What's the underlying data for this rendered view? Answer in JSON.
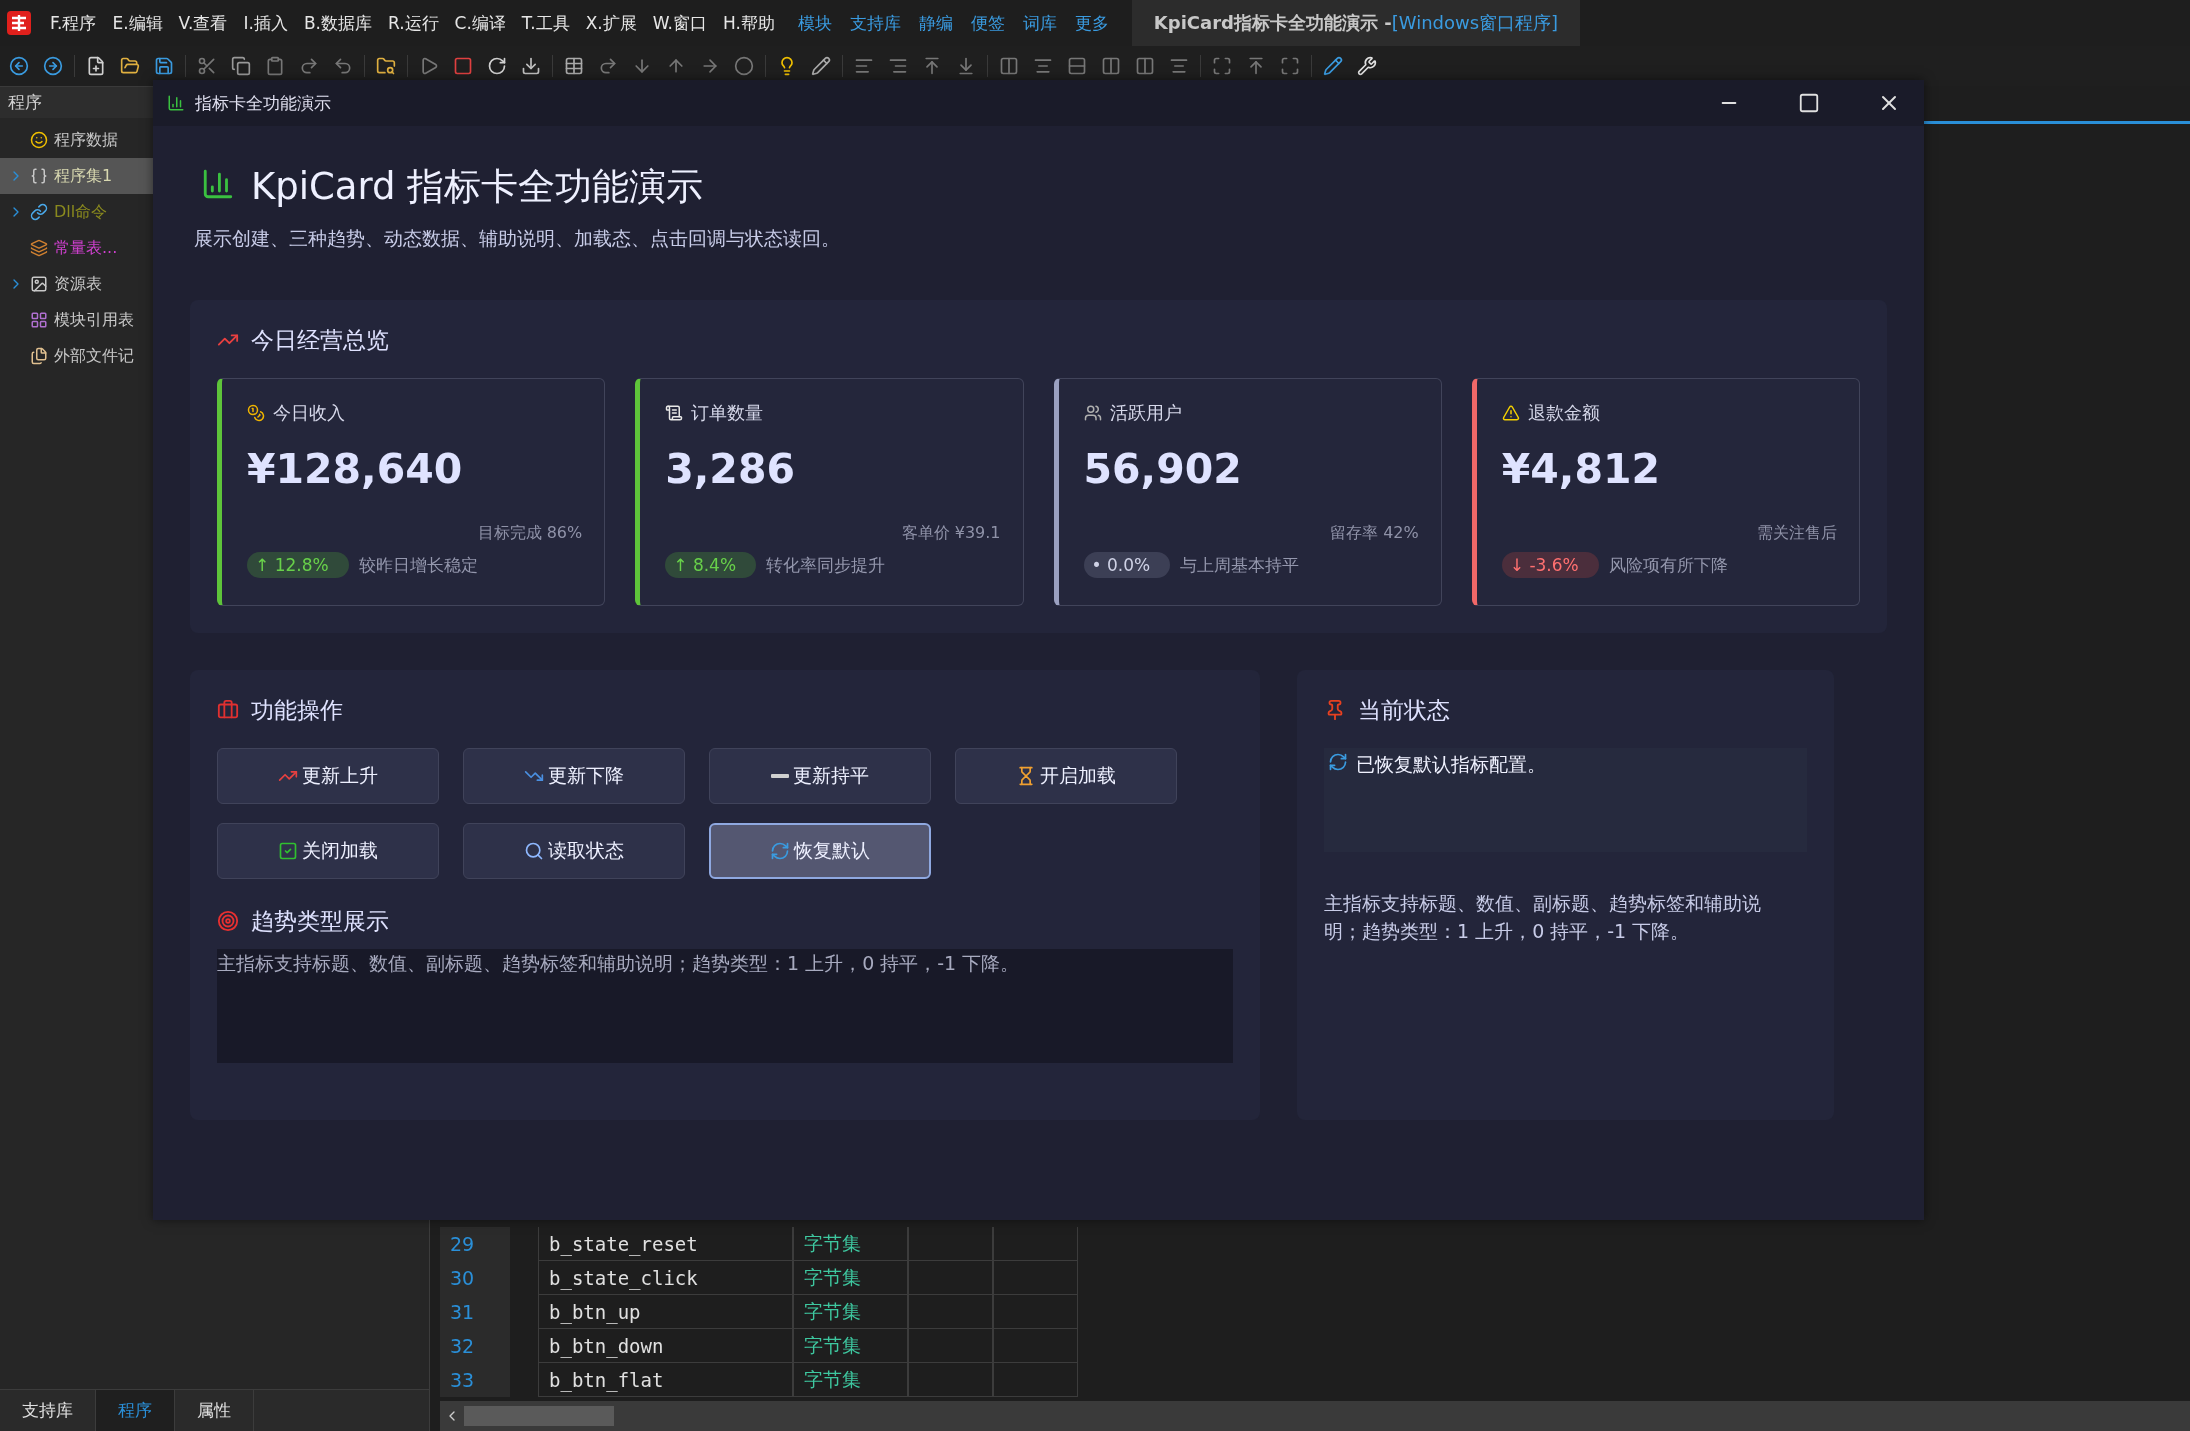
{
  "menu_bar": {
    "items": [
      "F.程序",
      "E.编辑",
      "V.查看",
      "I.插入",
      "B.数据库",
      "R.运行",
      "C.编译",
      "T.工具",
      "X.扩展",
      "W.窗口",
      "H.帮助"
    ],
    "quick_links": [
      "模块",
      "支持库",
      "静编",
      "便签",
      "词库",
      "更多"
    ],
    "title": "KpiCard指标卡全功能演示 - ",
    "title_mode": "[Windows窗口程序]"
  },
  "side_panel": {
    "header": "程序",
    "items": [
      {
        "label": "程序数据",
        "kind": "data",
        "expandable": false,
        "selected": false,
        "color": "#c8c8c8"
      },
      {
        "label": "程序集1",
        "kind": "class",
        "expandable": true,
        "selected": true,
        "color": "#d8d8b0"
      },
      {
        "label": "Dll命令",
        "kind": "dll",
        "expandable": true,
        "selected": false,
        "color": "#8a8a1e"
      },
      {
        "label": "常量表...",
        "kind": "const",
        "expandable": false,
        "selected": false,
        "color": "#d040d0"
      },
      {
        "label": "资源表",
        "kind": "resource",
        "expandable": true,
        "selected": false,
        "color": "#c8c8c8"
      },
      {
        "label": "模块引用表",
        "kind": "module",
        "expandable": false,
        "selected": false,
        "color": "#c8c8c8"
      },
      {
        "label": "外部文件记",
        "kind": "file",
        "expandable": false,
        "selected": false,
        "color": "#c8c8c8"
      }
    ],
    "tabs": [
      {
        "label": "支持库",
        "selected": false
      },
      {
        "label": "程序",
        "selected": true
      },
      {
        "label": "属性",
        "selected": false
      }
    ]
  },
  "code_table": {
    "rows": [
      {
        "line": "29",
        "name": "b_state_reset",
        "type": "字节集"
      },
      {
        "line": "30",
        "name": "b_state_click",
        "type": "字节集"
      },
      {
        "line": "31",
        "name": "b_btn_up",
        "type": "字节集"
      },
      {
        "line": "32",
        "name": "b_btn_down",
        "type": "字节集"
      },
      {
        "line": "33",
        "name": "b_btn_flat",
        "type": "字节集"
      }
    ]
  },
  "dialog": {
    "title": "指标卡全功能演示",
    "heading": "KpiCard 指标卡全功能演示",
    "subtitle": "展示创建、三种趋势、动态数据、辅助说明、加载态、点击回调与状态读回。",
    "overview": {
      "title": "今日经营总览",
      "cards": [
        {
          "label": "今日收入",
          "value": "¥128,640",
          "subtitle": "目标完成 86%",
          "kind": "up",
          "trend_label": "↑ 12.8%",
          "note": "较昨日增长稳定"
        },
        {
          "label": "订单数量",
          "value": "3,286",
          "subtitle": "客单价 ¥39.1",
          "kind": "up",
          "trend_label": "↑ 8.4%",
          "note": "转化率同步提升"
        },
        {
          "label": "活跃用户",
          "value": "56,902",
          "subtitle": "留存率 42%",
          "kind": "flat",
          "trend_label": "• 0.0%",
          "note": "与上周基本持平"
        },
        {
          "label": "退款金额",
          "value": "¥4,812",
          "subtitle": "需关注售后",
          "kind": "down",
          "trend_label": "↓ -3.6%",
          "note": "风险项有所下降"
        }
      ]
    },
    "actions": {
      "title": "功能操作",
      "buttons": [
        {
          "label": "更新上升",
          "focused": false
        },
        {
          "label": "更新下降",
          "focused": false
        },
        {
          "label": "更新持平",
          "focused": false
        },
        {
          "label": "开启加载",
          "focused": false
        },
        {
          "label": "关闭加载",
          "focused": false
        },
        {
          "label": "读取状态",
          "focused": false
        },
        {
          "label": "恢复默认",
          "focused": true
        }
      ]
    },
    "trend_demo": {
      "title": "趋势类型展示",
      "text": "主指标支持标题、数值、副标题、趋势标签和辅助说明；趋势类型：1 上升，0 持平，-1 下降。"
    },
    "status": {
      "title": "当前状态",
      "message": "已恢复默认指标配置。",
      "description": "主指标支持标题、数值、副标题、趋势标签和辅助说明；趋势类型：1 上升，0 持平，-1 下降。"
    }
  }
}
